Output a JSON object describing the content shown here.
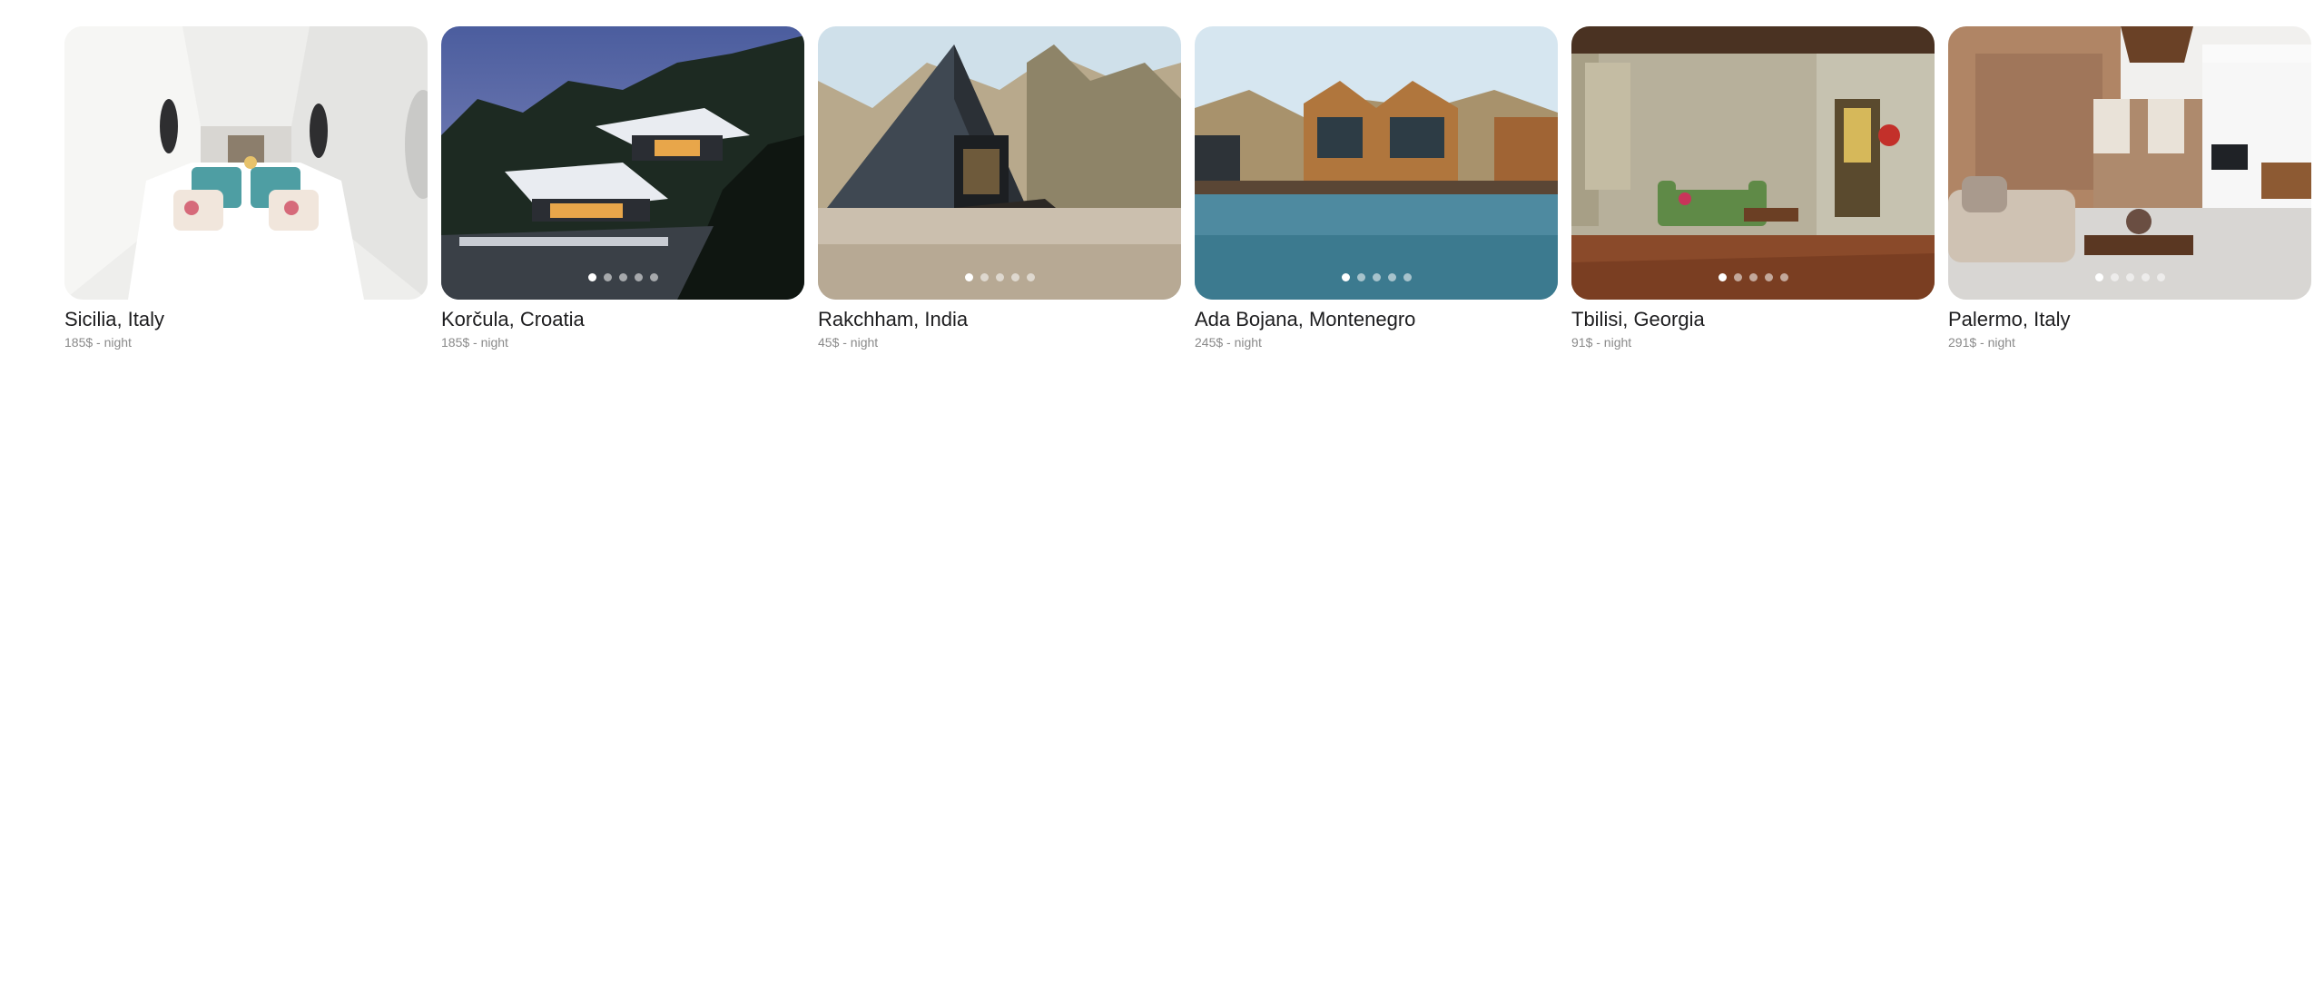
{
  "listings": [
    {
      "title": "Sicilia, Italy",
      "price": "185$ - night",
      "photo_icon": "white-capsule-bedroom-photo",
      "slides": 5,
      "active_slide": 1
    },
    {
      "title": "Korčula, Croatia",
      "price": "185$ - night",
      "photo_icon": "modern-cliff-villa-photo",
      "slides": 5,
      "active_slide": 1
    },
    {
      "title": "Rakchham, India",
      "price": "45$ - night",
      "photo_icon": "a-frame-cabin-photo",
      "slides": 5,
      "active_slide": 1
    },
    {
      "title": "Ada Bojana, Montenegro",
      "price": "245$ - night",
      "photo_icon": "river-bungalows-photo",
      "slides": 5,
      "active_slide": 1
    },
    {
      "title": "Tbilisi, Georgia",
      "price": "91$ - night",
      "photo_icon": "vintage-living-room-photo",
      "slides": 5,
      "active_slide": 1
    },
    {
      "title": "Palermo, Italy",
      "price": "291$ - night",
      "photo_icon": "stone-wall-loft-photo",
      "slides": 5,
      "active_slide": 1
    }
  ]
}
